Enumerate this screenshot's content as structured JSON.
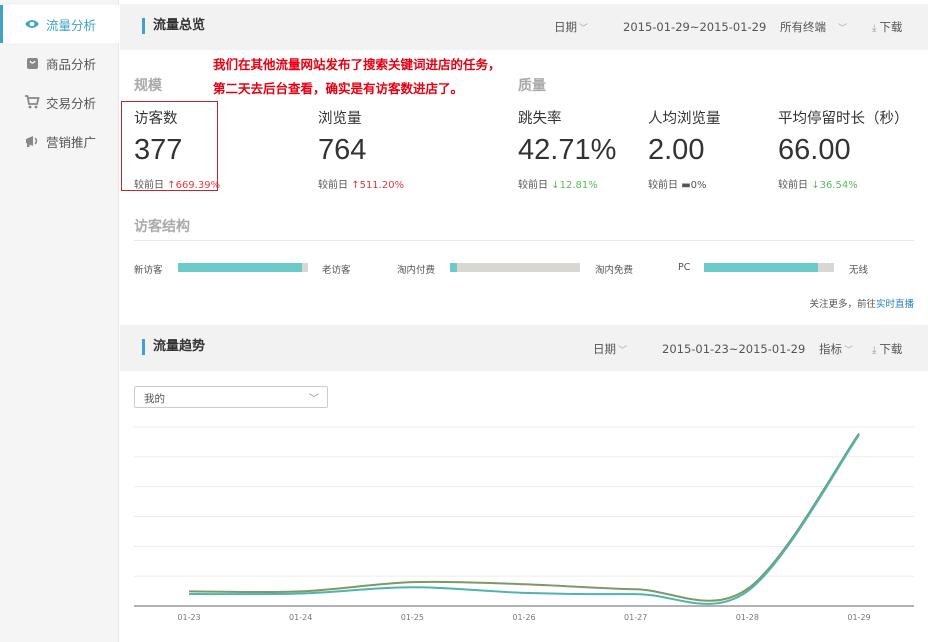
{
  "sidebar": {
    "items": [
      {
        "label": "流量分析",
        "icon": "eye-icon",
        "active": true
      },
      {
        "label": "商品分析",
        "icon": "bag-icon",
        "active": false
      },
      {
        "label": "交易分析",
        "icon": "cart-icon",
        "active": false
      },
      {
        "label": "营销推广",
        "icon": "megaphone-icon",
        "active": false
      }
    ]
  },
  "overview": {
    "title": "流量总览",
    "date_label": "日期",
    "date_range": "2015-01-29~2015-01-29",
    "terminal": "所有终端",
    "download": "下载",
    "group_scale": "规模",
    "group_quality": "质量",
    "compare_label": "较前日",
    "kpis": [
      {
        "name": "访客数",
        "value": "377",
        "change": "669.39%",
        "trend": "up"
      },
      {
        "name": "浏览量",
        "value": "764",
        "change": "511.20%",
        "trend": "up"
      },
      {
        "name": "跳失率",
        "value": "42.71%",
        "change": "12.81%",
        "trend": "down"
      },
      {
        "name": "人均浏览量",
        "value": "2.00",
        "change": "0%",
        "trend": "flat"
      },
      {
        "name": "平均停留时长（秒）",
        "value": "66.00",
        "change": "36.54%",
        "trend": "down"
      }
    ],
    "annotation": [
      "我们在其他流量网站发布了搜索关键词进店的任务，",
      "第二天去后台查看，确实是有访客数进店了。"
    ],
    "structure_title": "访客结构",
    "structure": [
      {
        "left": "新访客",
        "right": "老访客",
        "left_share": 0.95
      },
      {
        "left": "淘内付费",
        "right": "淘内免费",
        "left_share": 0.05
      },
      {
        "left": "PC",
        "right": "无线",
        "left_share": 0.88
      }
    ],
    "more_text": "关注更多，前往",
    "more_link": "实时直播"
  },
  "trend": {
    "title": "流量趋势",
    "date_label": "日期",
    "date_range": "2015-01-23~2015-01-29",
    "metric_label": "指标",
    "download": "下载",
    "dropdown_value": "我的"
  },
  "colors": {
    "accent": "#3fa3c9",
    "series_a": "#7b9a66",
    "series_b": "#4fb3b1",
    "bar_fill": "#6ccbc8",
    "annotation": "#e60012"
  },
  "chart_data": {
    "type": "line",
    "categories": [
      "01-23",
      "01-24",
      "01-25",
      "01-26",
      "01-27",
      "01-28",
      "01-29"
    ],
    "series": [
      {
        "values": [
          49,
          49,
          80,
          73,
          56,
          57,
          578
        ]
      },
      {
        "values": [
          40,
          42,
          63,
          44,
          40,
          49,
          573
        ]
      }
    ],
    "ylim": [
      0,
      600
    ],
    "grid": true
  }
}
